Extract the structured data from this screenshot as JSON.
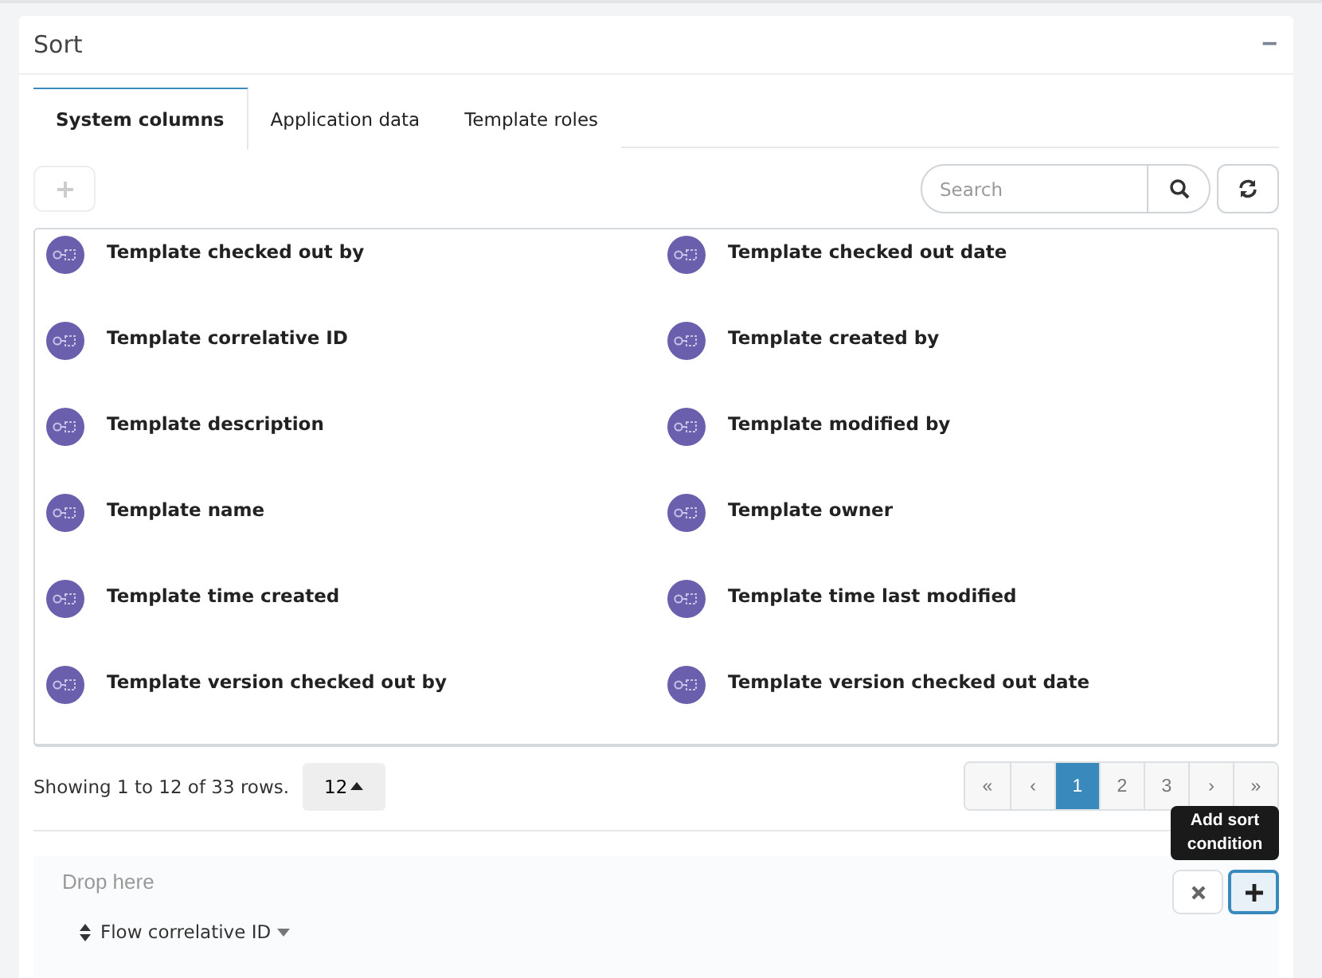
{
  "panel": {
    "title": "Sort",
    "collapse_icon": "−"
  },
  "tabs": [
    {
      "label": "System columns",
      "selected": true
    },
    {
      "label": "Application data",
      "selected": false
    },
    {
      "label": "Template roles",
      "selected": false
    }
  ],
  "search": {
    "placeholder": "Search"
  },
  "columns": [
    {
      "label": "Template checked out by"
    },
    {
      "label": "Template checked out date"
    },
    {
      "label": "Template correlative ID"
    },
    {
      "label": "Template created by"
    },
    {
      "label": "Template description"
    },
    {
      "label": "Template modified by"
    },
    {
      "label": "Template name"
    },
    {
      "label": "Template owner"
    },
    {
      "label": "Template time created"
    },
    {
      "label": "Template time last modified"
    },
    {
      "label": "Template version checked out by"
    },
    {
      "label": "Template version checked out date"
    }
  ],
  "footer": {
    "summary": "Showing 1 to 12 of 33 rows.",
    "page_size": "12"
  },
  "pagination": [
    {
      "label": "«",
      "selected": false
    },
    {
      "label": "‹",
      "selected": false
    },
    {
      "label": "1",
      "selected": true
    },
    {
      "label": "2",
      "selected": false
    },
    {
      "label": "3",
      "selected": false
    },
    {
      "label": "›",
      "selected": false
    },
    {
      "label": "»",
      "selected": false
    }
  ],
  "drop_zone": {
    "hint": "Drop here",
    "conditions": [
      {
        "label": "Flow correlative ID"
      }
    ]
  },
  "tooltip": "Add sort condition"
}
